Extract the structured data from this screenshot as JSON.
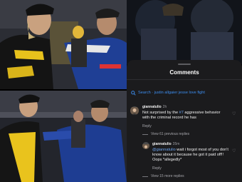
{
  "comments_panel": {
    "title": "Comments",
    "search_text": "Search · justin allgaier jesse love fight"
  },
  "comments": [
    {
      "username": "giannatulio",
      "time": "2h",
      "text_pre": "Not surprised by the ",
      "tag": "#7",
      "text_post": " aggressive behavior with the criminal record he has",
      "reply_label": "Reply",
      "view_replies_label": "View 61 previous replies"
    },
    {
      "username": "giannatulio",
      "time": "35m",
      "mention": "@giannatulio",
      "text_post": " wait i forgot most of you don't know about it because he got it paid off!! Oops *allegedly*",
      "reply_label": "Reply",
      "view_replies_label": "View 15 more replies"
    }
  ],
  "colors": {
    "panel_bg": "#1b1b1d",
    "link": "#3d8ef0",
    "muted_text": "#a5a5aa"
  },
  "icons": [
    "search-icon",
    "heart-icon",
    "avatar"
  ]
}
